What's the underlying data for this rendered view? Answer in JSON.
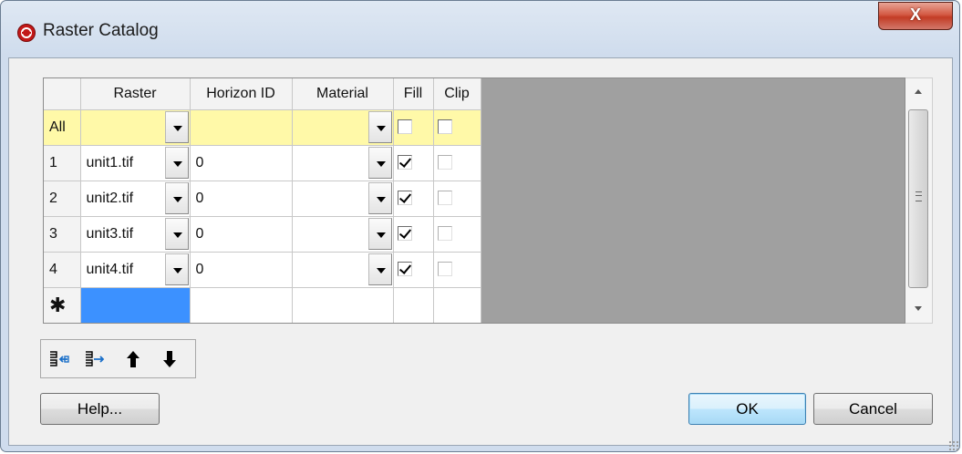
{
  "window": {
    "title": "Raster Catalog",
    "close_label": "X"
  },
  "table": {
    "columns": [
      "Raster",
      "Horizon ID",
      "Material",
      "Fill",
      "Clip"
    ],
    "all_row": {
      "label": "All",
      "raster": "",
      "horizon_id": "",
      "material": "",
      "fill": false,
      "clip": false
    },
    "rows": [
      {
        "index": "1",
        "raster": "unit1.tif",
        "horizon_id": "0",
        "material": "",
        "fill": true,
        "clip": false
      },
      {
        "index": "2",
        "raster": "unit2.tif",
        "horizon_id": "0",
        "material": "",
        "fill": true,
        "clip": false
      },
      {
        "index": "3",
        "raster": "unit3.tif",
        "horizon_id": "0",
        "material": "",
        "fill": true,
        "clip": false
      },
      {
        "index": "4",
        "raster": "unit4.tif",
        "horizon_id": "0",
        "material": "",
        "fill": true,
        "clip": false
      }
    ],
    "new_row_marker": "✱"
  },
  "toolbar": {
    "icons": [
      "insert-row-icon",
      "append-row-icon",
      "move-up-icon",
      "move-down-icon"
    ]
  },
  "buttons": {
    "help": "Help...",
    "ok": "OK",
    "cancel": "Cancel"
  },
  "colors": {
    "all_row": "#fff9a8",
    "selection": "#3c91ff",
    "grid_empty": "#a0a0a0"
  }
}
